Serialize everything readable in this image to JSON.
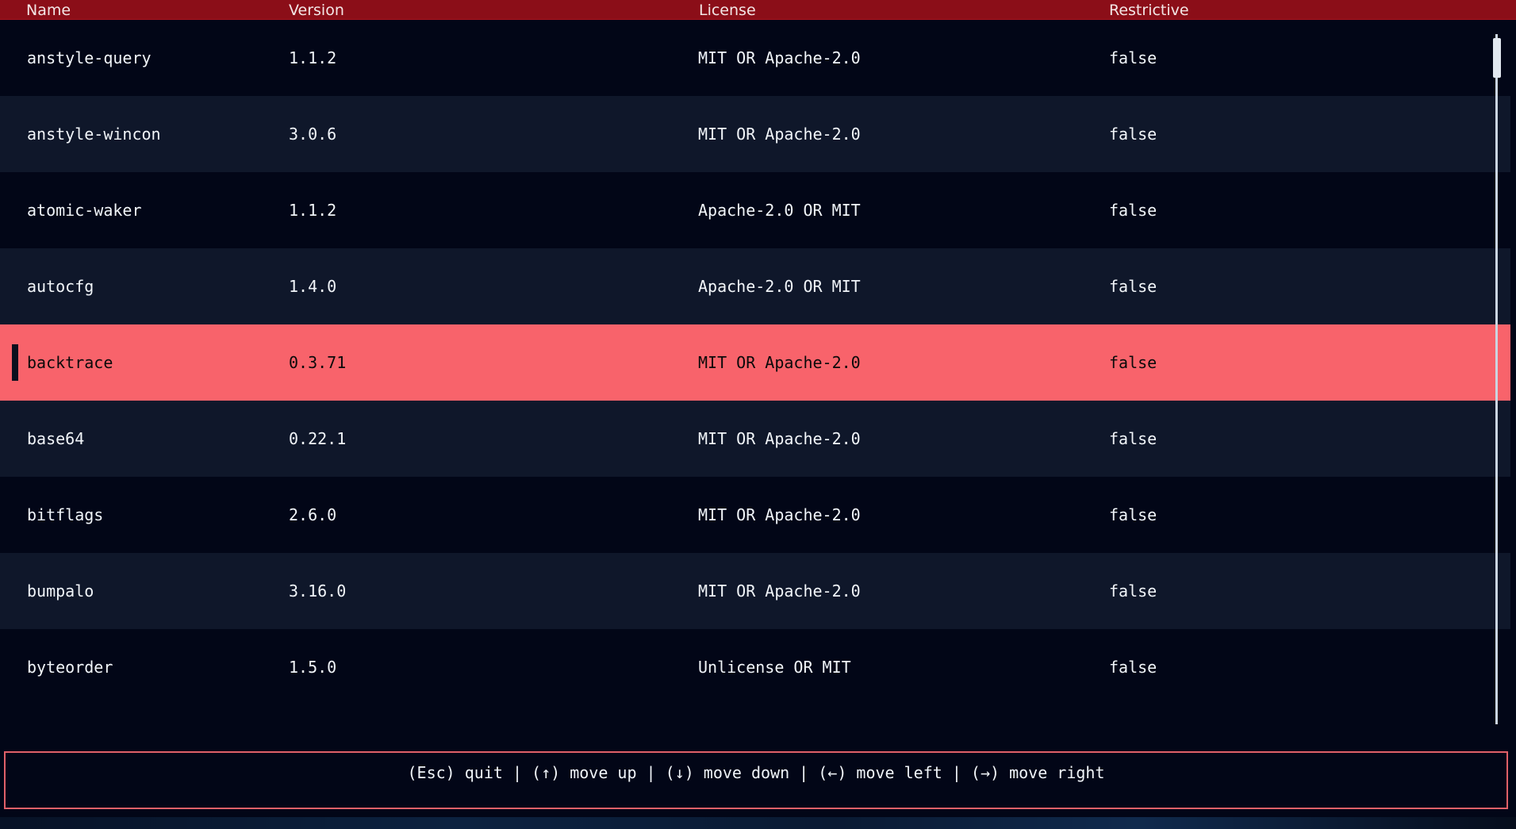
{
  "header": {
    "name": "Name",
    "version": "Version",
    "license": "License",
    "restrictive": "Restrictive"
  },
  "rows": [
    {
      "name": "anstyle-query",
      "version": "1.1.2",
      "license": "MIT OR Apache-2.0",
      "restrictive": "false"
    },
    {
      "name": "anstyle-wincon",
      "version": "3.0.6",
      "license": "MIT OR Apache-2.0",
      "restrictive": "false"
    },
    {
      "name": "atomic-waker",
      "version": "1.1.2",
      "license": "Apache-2.0 OR MIT",
      "restrictive": "false"
    },
    {
      "name": "autocfg",
      "version": "1.4.0",
      "license": "Apache-2.0 OR MIT",
      "restrictive": "false"
    },
    {
      "name": "backtrace",
      "version": "0.3.71",
      "license": "MIT OR Apache-2.0",
      "restrictive": "false"
    },
    {
      "name": "base64",
      "version": "0.22.1",
      "license": "MIT OR Apache-2.0",
      "restrictive": "false"
    },
    {
      "name": "bitflags",
      "version": "2.6.0",
      "license": "MIT OR Apache-2.0",
      "restrictive": "false"
    },
    {
      "name": "bumpalo",
      "version": "3.16.0",
      "license": "MIT OR Apache-2.0",
      "restrictive": "false"
    },
    {
      "name": "byteorder",
      "version": "1.5.0",
      "license": "Unlicense OR MIT",
      "restrictive": "false"
    }
  ],
  "selected_row_index": 4,
  "footer": {
    "help": "(Esc) quit | (↑) move up | (↓) move down | (←) move left | (→) move right"
  },
  "colors": {
    "header_bg": "#8b0e18",
    "selected_row_bg": "#f8636b",
    "row_even_bg": "#0f172a",
    "row_odd_bg": "#020617",
    "footer_border": "#e06068"
  }
}
